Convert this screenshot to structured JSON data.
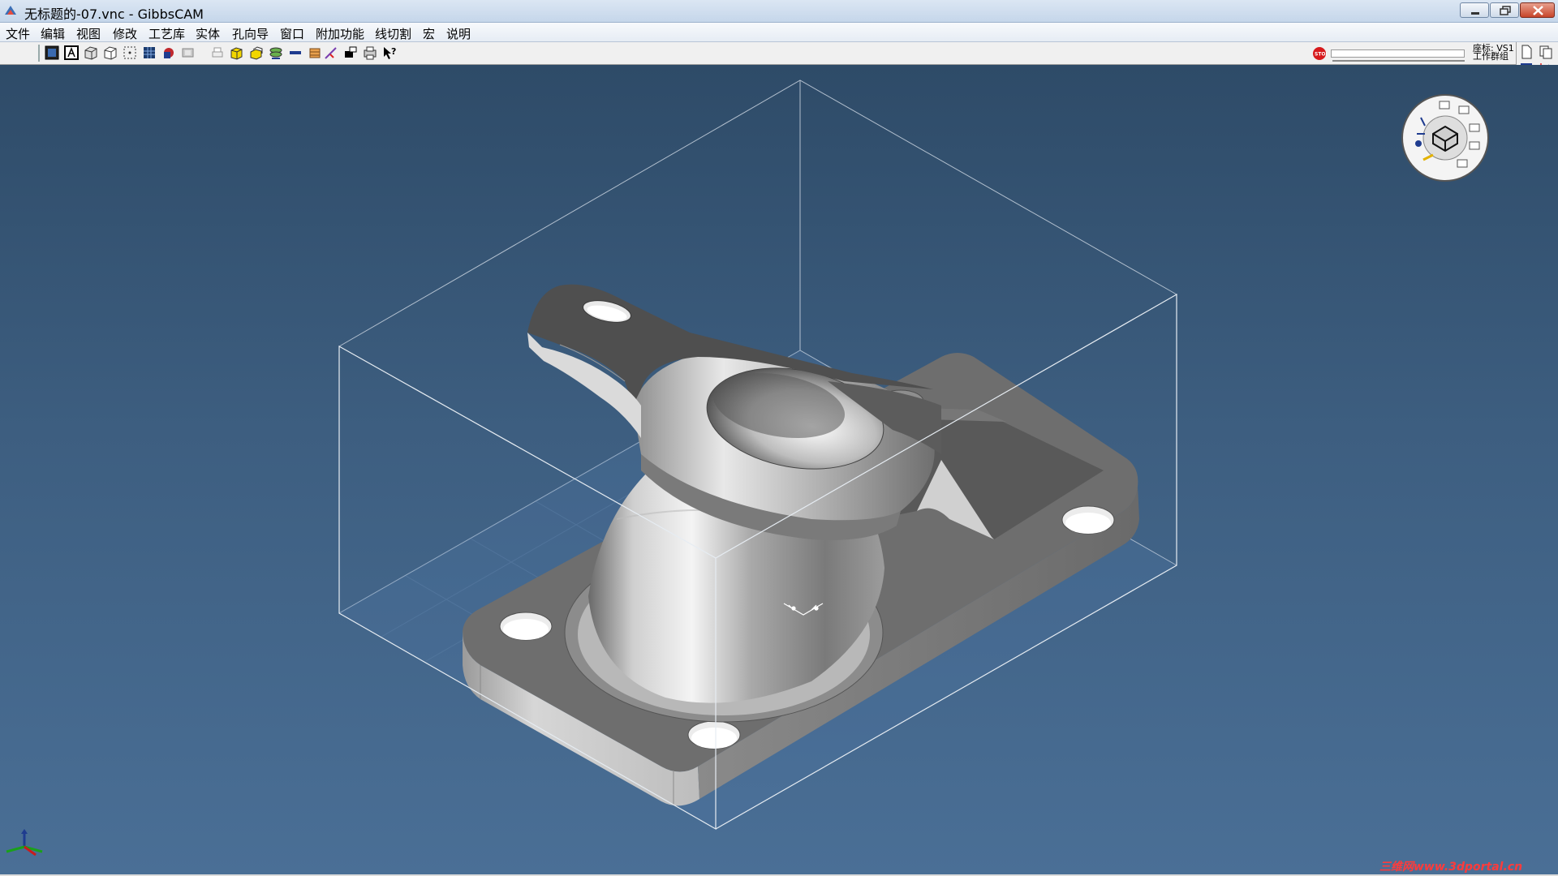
{
  "window": {
    "title": "无标题的-07.vnc - GibbsCAM"
  },
  "menu": [
    "文件",
    "编辑",
    "视图",
    "修改",
    "工艺库",
    "实体",
    "孔向导",
    "窗口",
    "附加功能",
    "线切割",
    "宏",
    "说明"
  ],
  "toolbar": {
    "icons": [
      "solid-view-icon",
      "wireframe-view-icon",
      "shaded-view-icon",
      "box-view-icon",
      "select-icon",
      "grid-icon",
      "color-icon",
      "transform-icon",
      "solid-box-icon",
      "layer-icon",
      "stack-icon",
      "profile-icon",
      "block-icon",
      "arrow-icon",
      "cursor-icon",
      "print-icon",
      "help-icon"
    ],
    "coord_label_1": "座标: VS1",
    "coord_label_2": "工作群组"
  },
  "viewport": {
    "watermark": "三维网www.3dportal.cn",
    "background_top": "#2e4b68",
    "background_bottom": "#4a6f96"
  },
  "colors": {
    "part_light": "#d9d9d9",
    "part_mid": "#9d9d9d",
    "part_dark": "#5c5c5c",
    "bounding_box": "#ffffff"
  }
}
